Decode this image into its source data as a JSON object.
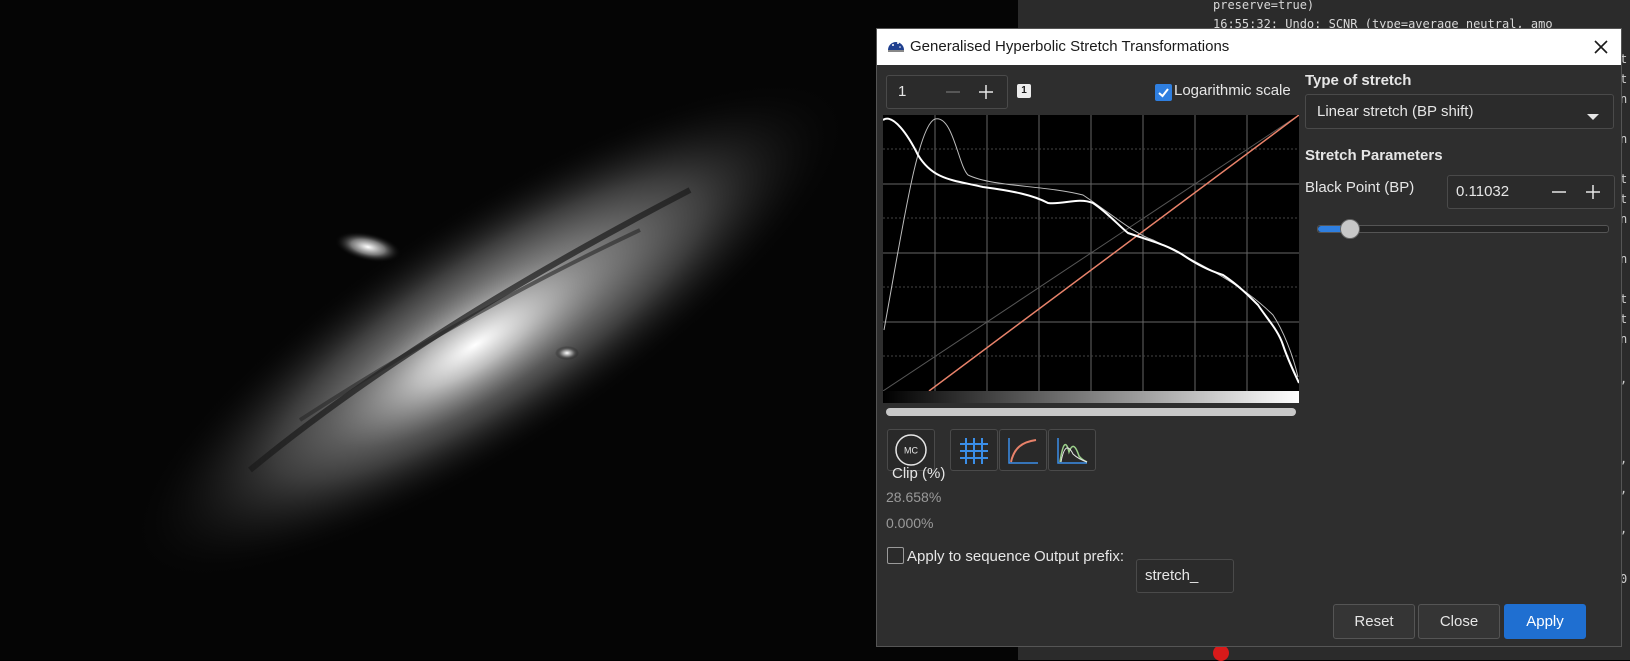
{
  "console": {
    "lines": [
      "preserve=true)",
      "16:55:32: Undo: SCNR (type=average neutral, amo"
    ]
  },
  "dialog": {
    "title": "Generalised Hyperbolic Stretch Transformations",
    "channel_value": "1",
    "badge": "1",
    "log_scale_label": "Logarithmic scale",
    "log_scale_checked": true,
    "type_of_stretch_heading": "Type of stretch",
    "stretch_type_selected": "Linear stretch (BP shift)",
    "stretch_params_heading": "Stretch Parameters",
    "black_point_label": "Black Point (BP)",
    "black_point_value": "0.11032",
    "black_point_slider": 0.11032,
    "mc_label": "MC",
    "clip_label": "Clip (%)",
    "clip_low": "28.658%",
    "clip_high": "0.000%",
    "apply_seq_label": "Apply to sequence",
    "apply_seq_checked": false,
    "output_prefix_label": "Output prefix:",
    "output_prefix_value": "stretch_",
    "buttons": {
      "reset": "Reset",
      "close": "Close",
      "apply": "Apply"
    }
  },
  "colors": {
    "accent": "#1f6fd1",
    "curve": "#e8826a",
    "dialog_bg": "#2e2e2e"
  }
}
